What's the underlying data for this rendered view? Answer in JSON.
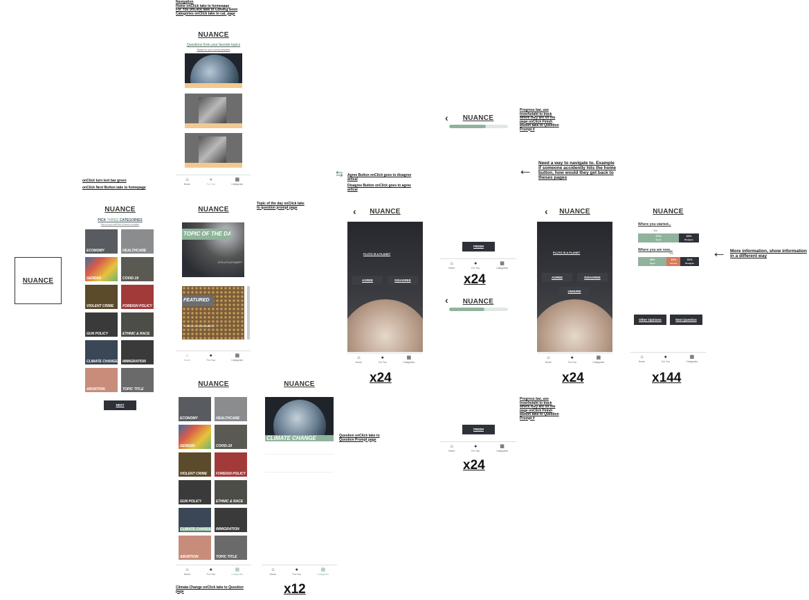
{
  "brand": "NUANCE",
  "notes": {
    "navigation": [
      "Navigation",
      "Home onClick take to homepage",
      "For You onClick take to Coming Soon",
      "Categories onClick take to cat. page"
    ],
    "turn_bar_green": "onClick turn text bar green",
    "next_homepage": "onClick Next Button take to homepage",
    "topic_of_day": "Topic of the day onClick take to question prompt page",
    "agree_disagree": "Agree Button onClick goes to disagree artical",
    "disagree_agree": "Disagree Button onClick goes to agree artical",
    "progress_top": "Progress bar, use inverheight to track where they are on the page onClick Finish Button take to Question Prompt #",
    "progress_bottom": "Progress bar, use inverheight to track where they are on the page onClick Finish Button take to Question Prompt #",
    "navigate": "Need a way to navigate to. Example if someone accidently hits the home button, how would they get back to theses pages",
    "more_info": "More information, show information in a different way",
    "question_click": "Question onClick take to Question Prompt page",
    "climate_click": "Climata Change onClick take to Question page"
  },
  "multipliers": {
    "a": "x24",
    "b": "x24",
    "c": "x24",
    "d": "x144",
    "e": "x24",
    "f": "x12"
  },
  "home": {
    "subtitle": "Questions from your favorite topics",
    "subsub": "Based on your survey answers"
  },
  "pick": {
    "prefix": "PICK",
    "count": "THREE",
    "suffix": "CATEGORIES",
    "hint": "this so you will like it focus on dates",
    "next": "NEXT"
  },
  "categories": [
    "ECONOMY",
    "HEALTHCARE",
    "GENDER",
    "COVID-19",
    "VIOLENT CRIME",
    "FOREIGN POLICY",
    "GUN POLICY",
    "ETHNIC & RACE",
    "CLIMATE CHANGE",
    "IMMIGRATION",
    "ABORTION",
    "TOPIC TITLE"
  ],
  "categories_b": [
    "ECONOMY",
    "HEALTHCARE",
    "GENDER",
    "COVID-19",
    "VIOLENT CRIME",
    "FOREIGN POLICY",
    "GUN POLICY",
    "ETHNIC & RACE",
    "CLIMATE CHANGE",
    "IMMIGRATION",
    "ABORTION",
    "TOPIC TITLE"
  ],
  "feed": {
    "topic": "TOPIC OF THE DAY",
    "topic_tag": "IS PLUTO A PLANET?",
    "featured": "FEATURED",
    "featured_tag": "LOREAL ON BAN BABIES?"
  },
  "climate": {
    "title": "CLIMATE CHANGE"
  },
  "question": {
    "text": "PLUTO IS A PLANET",
    "agree": "AGREE",
    "disagree": "DISAGREE",
    "unsure": "UNSURE",
    "finish": "FINISH"
  },
  "results": {
    "started": "Where you started...",
    "now": "Where you are now...",
    "you": "You",
    "bar1": [
      {
        "v": "67%",
        "l": "Agree"
      },
      {
        "v": "33%",
        "l": "Disagree"
      }
    ],
    "bar2": [
      {
        "v": "48%",
        "l": "Agree"
      },
      {
        "v": "23%",
        "l": "Unsure"
      },
      {
        "v": "31%",
        "l": "Disagree"
      }
    ],
    "other": "Other Opinions",
    "next": "Next Question"
  },
  "nav": {
    "home": "Home",
    "foryou": "For You",
    "categories": "Categories"
  },
  "progress": [
    0.62,
    0.6
  ],
  "results_split": {
    "bar1": [
      0.67,
      0.33
    ],
    "bar2": [
      0.48,
      0.23,
      0.31
    ]
  },
  "colors": {
    "accent": "#8fb39b",
    "dark": "#2f3138",
    "sand": "#f3c88e",
    "orange": "#d9785a"
  }
}
